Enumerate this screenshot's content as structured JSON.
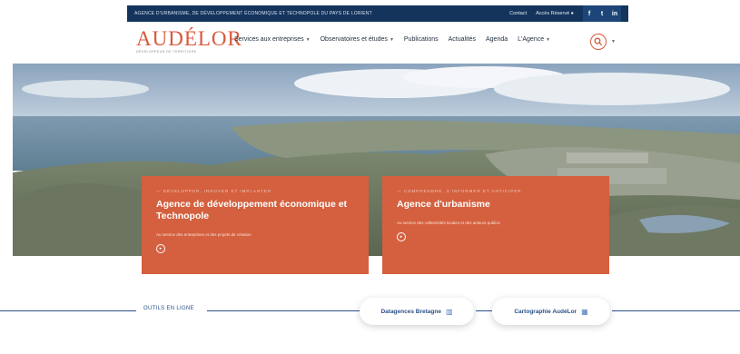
{
  "topbar": {
    "tagline": "AGENCE D'URBANISME, DE DÉVELOPPEMENT ÉCONOMIQUE ET TECHNOPOLE DU PAYS DE LORIENT",
    "contact": "Contact",
    "reserved": "Accès Réservé",
    "social": [
      "f",
      "t",
      "in"
    ]
  },
  "logo": {
    "word": "AUDÉLOR",
    "sub": "DÉVELOPPEUR DE TERRITOIRE"
  },
  "nav": [
    {
      "label": "Services aux entreprises",
      "caret": true
    },
    {
      "label": "Observatoires et études",
      "caret": true
    },
    {
      "label": "Publications",
      "caret": false
    },
    {
      "label": "Actualités",
      "caret": false
    },
    {
      "label": "Agenda",
      "caret": false
    },
    {
      "label": "L'Agence",
      "caret": true
    }
  ],
  "cards": {
    "left": {
      "kicker": "— DÉVELOPPER, INNOVER ET IMPLANTER",
      "title": "Agence de développement économique et Technopole",
      "desc": "Au service des entreprises et des projets de création"
    },
    "right": {
      "kicker": "— COMPRENDRE, S'INFORMER ET ANTICIPER",
      "title": "Agence d'urbanisme",
      "desc": "Au service des collectivités locales et des acteurs publics"
    }
  },
  "tools": {
    "label": "OUTILS EN LIGNE",
    "datagences": "Datagences Bretagne",
    "cartographie": "Cartographie AudéLor"
  },
  "colors": {
    "navy": "#14345c",
    "accent": "#d9573a",
    "card": "#d4603f",
    "link": "#2b5088"
  }
}
